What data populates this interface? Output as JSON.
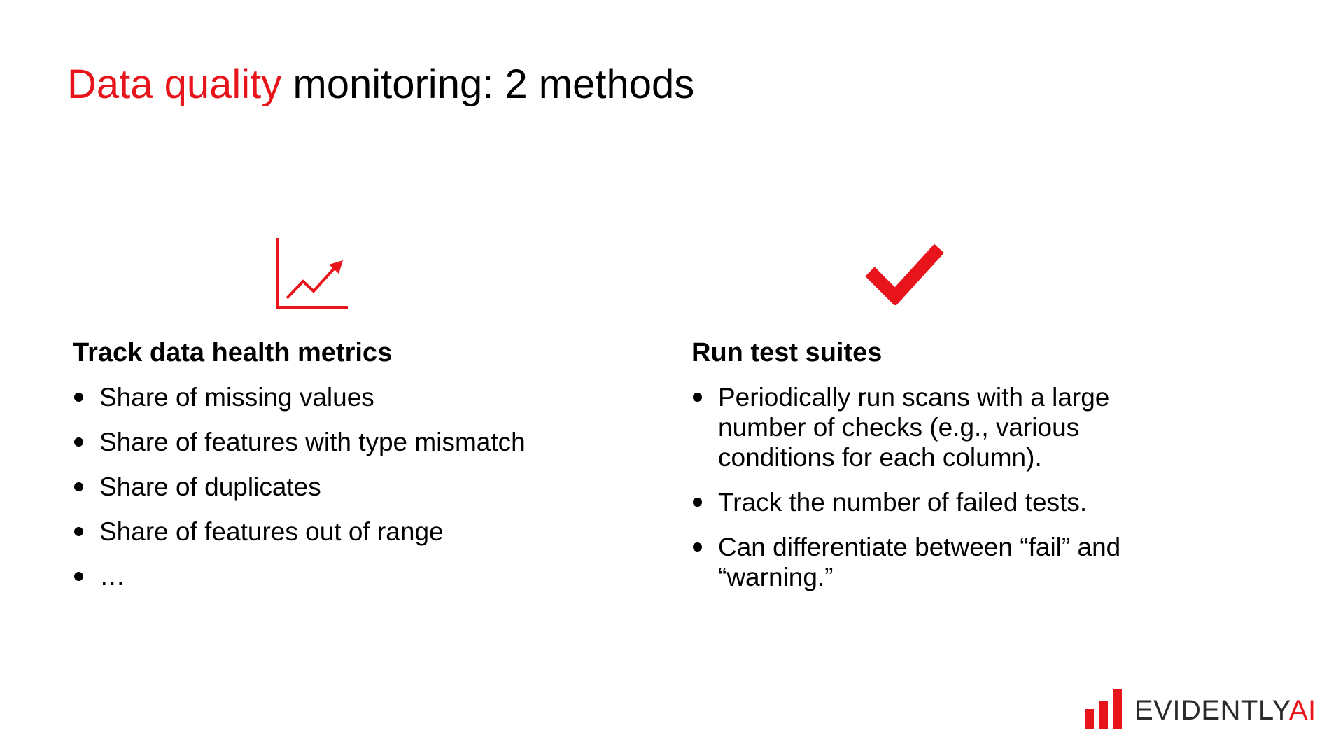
{
  "title": {
    "accent": "Data quality",
    "rest": " monitoring: 2 methods"
  },
  "colors": {
    "accent": "#e8141b",
    "text": "#000000",
    "brand_text": "#2b2b2b"
  },
  "left": {
    "icon": "trend-chart-icon",
    "heading": "Track data health metrics",
    "items": [
      "Share of missing values",
      "Share of features with type mismatch",
      "Share of duplicates",
      "Share of features out of range",
      "…"
    ]
  },
  "right": {
    "icon": "checkmark-icon",
    "heading": "Run test suites",
    "items": [
      "Periodically run scans with a large number of checks (e.g., various conditions for each column).",
      "Track the number of failed tests.",
      "Can differentiate between “fail” and “warning.”"
    ]
  },
  "brand": {
    "icon": "evidently-bars-logo-icon",
    "name": "EVIDENTLY",
    "suffix": "AI"
  }
}
